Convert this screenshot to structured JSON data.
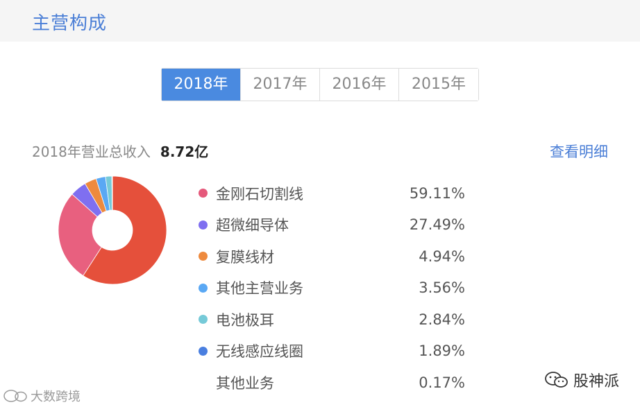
{
  "header": {
    "title": "主营构成"
  },
  "tabs": [
    {
      "label": "2018年",
      "active": true
    },
    {
      "label": "2017年",
      "active": false
    },
    {
      "label": "2016年",
      "active": false
    },
    {
      "label": "2015年",
      "active": false
    }
  ],
  "summary": {
    "label": "2018年营业总收入",
    "value": "8.72亿"
  },
  "detail_link": "查看明细",
  "chart_data": {
    "type": "pie",
    "donut": true,
    "categories": [
      "金刚石切割线",
      "超微细导体",
      "复膜线材",
      "其他主营业务",
      "电池极耳",
      "无线感应线圈",
      "其他业务"
    ],
    "values": [
      59.11,
      27.49,
      4.94,
      3.56,
      2.84,
      1.89,
      0.17
    ],
    "labels": [
      "59.11%",
      "27.49%",
      "4.94%",
      "3.56%",
      "2.84%",
      "1.89%",
      "0.17%"
    ],
    "colors": [
      "#e5503b",
      "#e8607f",
      "#7f6ff0",
      "#ee8a3e",
      "#5aa8f4",
      "#76cad8",
      "#4a7fe0"
    ],
    "legend_colors": [
      "#e5597b",
      "#7f6ff0",
      "#ee8a3e",
      "#5aa8f4",
      "#76cad8",
      "#4a7fe0",
      null
    ],
    "legend_position": "right"
  },
  "watermarks": {
    "left": "大数跨境",
    "right": "股神派"
  }
}
